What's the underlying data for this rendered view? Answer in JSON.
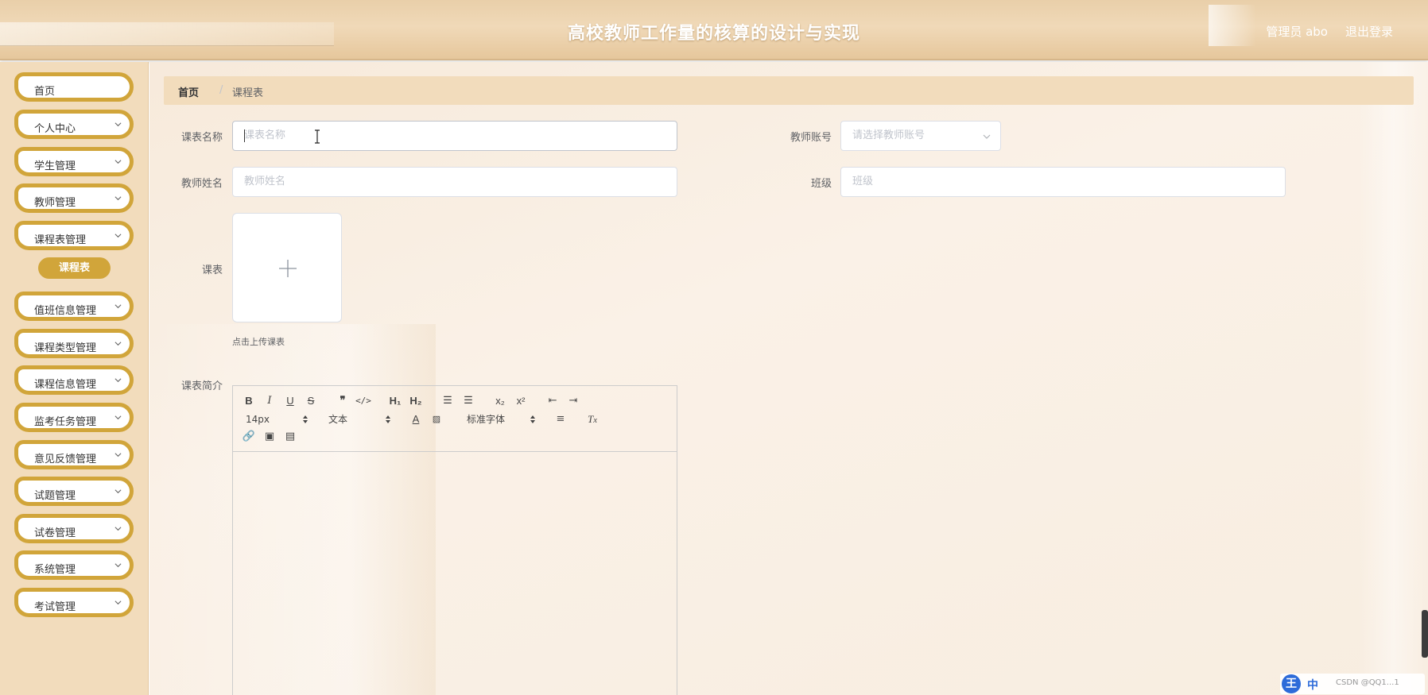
{
  "header": {
    "title": "高校教师工作量的核算的设计与实现",
    "user": "管理员 abo",
    "logout": "退出登录"
  },
  "sidebar": {
    "items": [
      {
        "label": "首页",
        "has_chevron": false
      },
      {
        "label": "个人中心",
        "has_chevron": true
      },
      {
        "label": "学生管理",
        "has_chevron": true
      },
      {
        "label": "教师管理",
        "has_chevron": true
      },
      {
        "label": "课程表管理",
        "has_chevron": true
      },
      {
        "label": "值班信息管理",
        "has_chevron": true
      },
      {
        "label": "课程类型管理",
        "has_chevron": true
      },
      {
        "label": "课程信息管理",
        "has_chevron": true
      },
      {
        "label": "监考任务管理",
        "has_chevron": true
      },
      {
        "label": "意见反馈管理",
        "has_chevron": true
      },
      {
        "label": "试题管理",
        "has_chevron": true
      },
      {
        "label": "试卷管理",
        "has_chevron": true
      },
      {
        "label": "系统管理",
        "has_chevron": true
      },
      {
        "label": "考试管理",
        "has_chevron": true
      }
    ],
    "active_submenu": "课程表"
  },
  "breadcrumb": {
    "home": "首页",
    "separator": "/",
    "current": "课程表"
  },
  "form": {
    "name_label": "课表名称",
    "name_placeholder": "课表名称",
    "teacher_account_label": "教师账号",
    "teacher_account_placeholder": "请选择教师账号",
    "teacher_name_label": "教师姓名",
    "teacher_name_placeholder": "教师姓名",
    "class_label": "班级",
    "class_placeholder": "班级",
    "schedule_label": "课表",
    "upload_tip": "点击上传课表",
    "intro_label": "课表简介"
  },
  "editor": {
    "font_size": "14px",
    "header_picker": "文本",
    "font_family": "标准字体"
  },
  "tray": {
    "ime_icon": "王",
    "ime_mode": "中",
    "watermark": "CSDN @QQ1...1"
  },
  "colors": {
    "accent": "#d1a53a",
    "sidebar_bg": "#f2dcbc",
    "header_bg": "#ecd3ae"
  }
}
